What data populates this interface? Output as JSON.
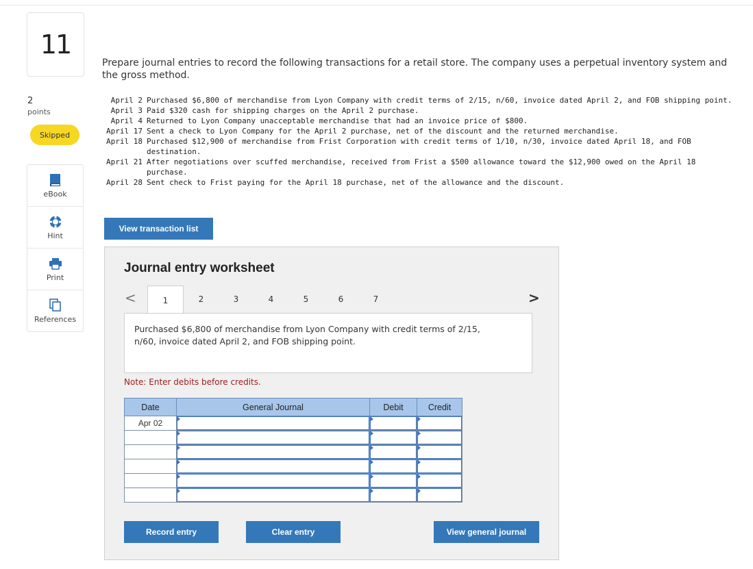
{
  "question": {
    "number": "11",
    "points_value": "2",
    "points_label": "points",
    "status": "Skipped"
  },
  "tools": [
    {
      "label": "eBook",
      "icon": "book-icon"
    },
    {
      "label": "Hint",
      "icon": "lifebuoy-icon"
    },
    {
      "label": "Print",
      "icon": "printer-icon"
    },
    {
      "label": "References",
      "icon": "copy-icon"
    }
  ],
  "prompt": "Prepare journal entries to record the following transactions for a retail store. The company uses a perpetual inventory system and the gross method.",
  "transactions": [
    {
      "date": " April 2",
      "text": "Purchased $6,800 of merchandise from Lyon Company with credit terms of 2/15, n/60, invoice dated April 2, and FOB shipping point."
    },
    {
      "date": " April 3",
      "text": "Paid $320 cash for shipping charges on the April 2 purchase."
    },
    {
      "date": " April 4",
      "text": "Returned to Lyon Company unacceptable merchandise that had an invoice price of $800."
    },
    {
      "date": "April 17",
      "text": "Sent a check to Lyon Company for the April 2 purchase, net of the discount and the returned merchandise."
    },
    {
      "date": "April 18",
      "text": "Purchased $12,900 of merchandise from Frist Corporation with credit terms of 1/10, n/30, invoice dated April 18, and FOB destination."
    },
    {
      "date": "April 21",
      "text": "After negotiations over scuffed merchandise, received from Frist a $500 allowance toward the $12,900 owed on the April 18 purchase."
    },
    {
      "date": "April 28",
      "text": "Sent check to Frist paying for the April 18 purchase, net of the allowance and the discount."
    }
  ],
  "view_transactions_label": "View transaction list",
  "worksheet": {
    "title": "Journal entry worksheet",
    "prev_symbol": "<",
    "next_symbol": ">",
    "tabs": [
      "1",
      "2",
      "3",
      "4",
      "5",
      "6",
      "7"
    ],
    "active_tab": "1",
    "description": "Purchased $6,800 of merchandise from Lyon Company with credit terms of 2/15, n/60, invoice dated April 2, and FOB shipping point.",
    "note": "Note: Enter debits before credits.",
    "columns": {
      "date": "Date",
      "journal": "General Journal",
      "debit": "Debit",
      "credit": "Credit"
    },
    "rows": [
      {
        "date": "Apr 02",
        "account": "",
        "debit": "",
        "credit": ""
      },
      {
        "date": "",
        "account": "",
        "debit": "",
        "credit": ""
      },
      {
        "date": "",
        "account": "",
        "debit": "",
        "credit": ""
      },
      {
        "date": "",
        "account": "",
        "debit": "",
        "credit": ""
      },
      {
        "date": "",
        "account": "",
        "debit": "",
        "credit": ""
      },
      {
        "date": "",
        "account": "",
        "debit": "",
        "credit": ""
      }
    ],
    "buttons": {
      "record": "Record entry",
      "clear": "Clear entry",
      "view_journal": "View general journal"
    }
  },
  "colors": {
    "accent": "#3578b9",
    "badge": "#f7d724",
    "header": "#a7c6ea",
    "note": "#9b1c1c"
  }
}
